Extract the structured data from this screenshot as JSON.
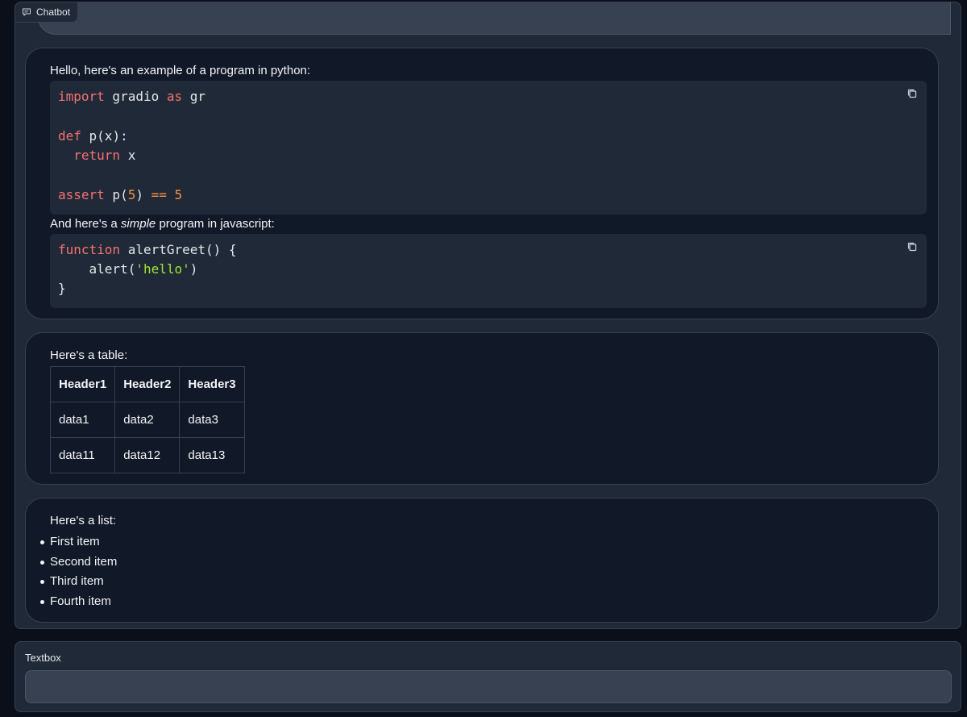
{
  "chatbot": {
    "label": "Chatbot",
    "messages": [
      {
        "intro": "Hello, here's an example of a program in python:",
        "between_before": "And here's a ",
        "between_emph": "simple",
        "between_after": " program in javascript:"
      },
      {
        "intro": "Here's a table:",
        "table": {
          "headers": [
            "Header1",
            "Header2",
            "Header3"
          ],
          "rows": [
            [
              "data1",
              "data2",
              "data3"
            ],
            [
              "data11",
              "data12",
              "data13"
            ]
          ]
        }
      },
      {
        "intro": "Here's a list:",
        "items": [
          "First item",
          "Second item",
          "Third item",
          "Fourth item"
        ]
      }
    ],
    "python_code": {
      "l1": [
        "import",
        " gradio ",
        "as",
        " gr"
      ],
      "l2": [
        "def",
        " p(x):"
      ],
      "l3": [
        "  ",
        "return",
        " x"
      ],
      "l4": [
        "assert",
        " p(",
        "5",
        ") ",
        "==",
        " ",
        "5"
      ]
    },
    "js_code": {
      "l1": [
        "function",
        " alertGreet() {"
      ],
      "l2": [
        "    alert(",
        "'hello'",
        ")"
      ],
      "l3": [
        "}"
      ]
    }
  },
  "textbox": {
    "label": "Textbox",
    "value": "",
    "placeholder": ""
  },
  "icons": [
    "chat-bubble-icon",
    "copy-icon"
  ],
  "colors": {
    "background": "#0b0f19",
    "panel": "#1f2937",
    "bubble": "#111827",
    "keyword": "#f87171",
    "string": "#a3e635",
    "number": "#fb923c"
  }
}
